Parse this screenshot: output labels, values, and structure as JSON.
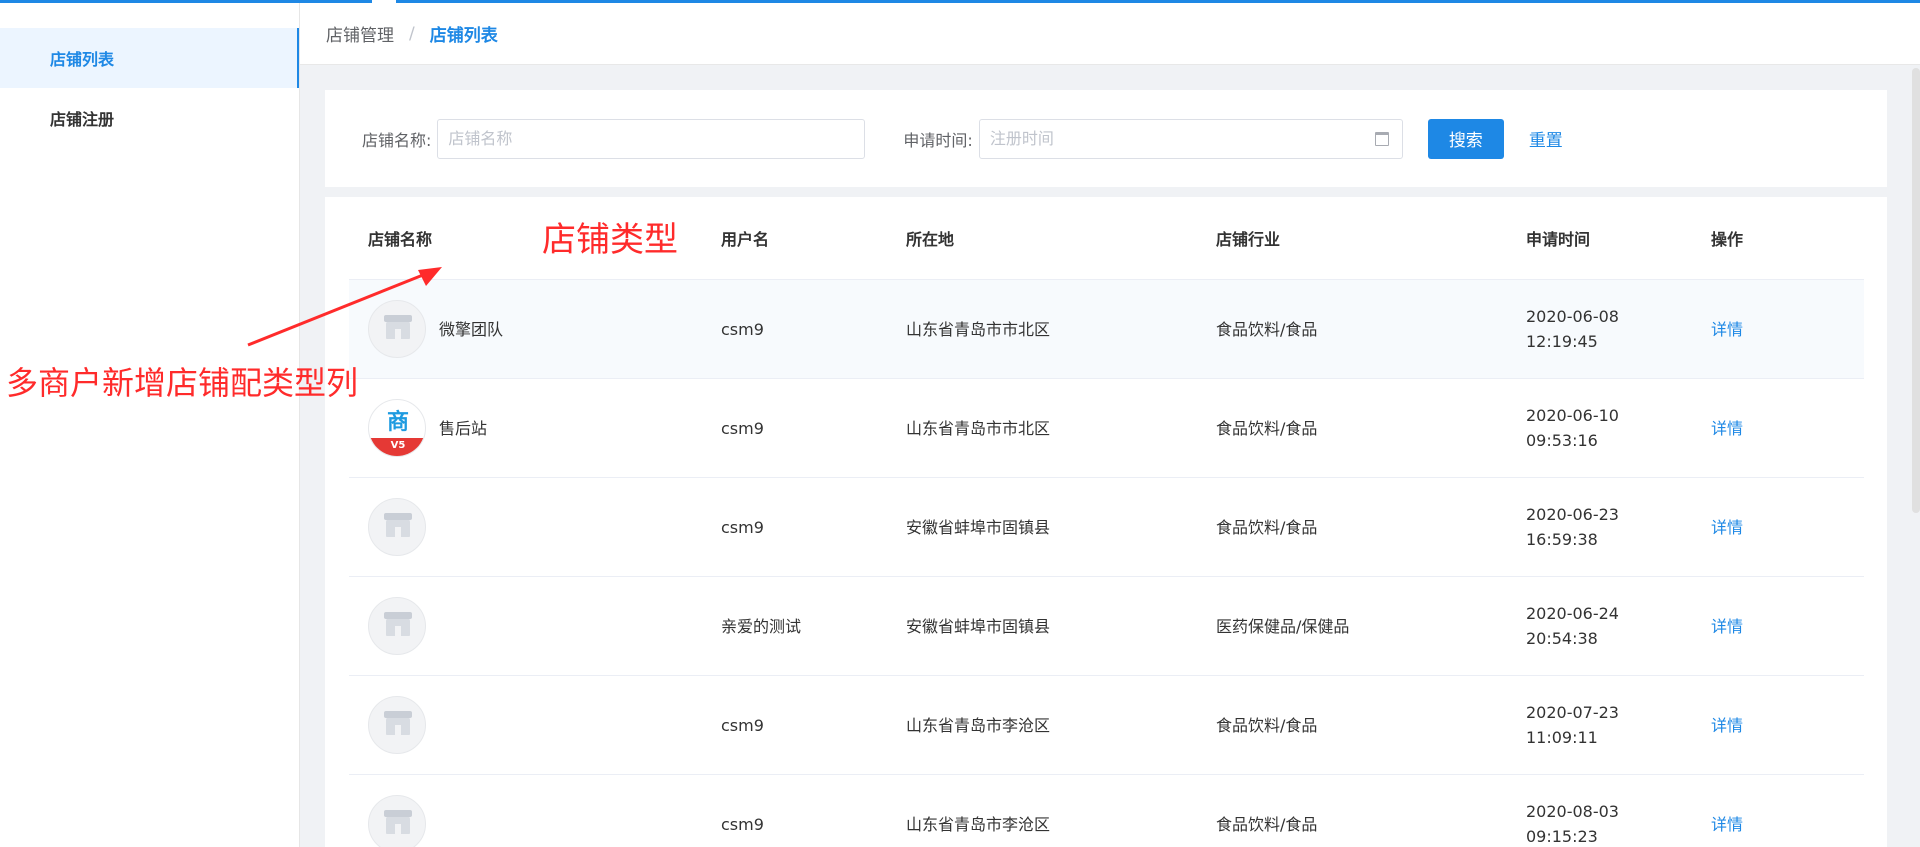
{
  "sidebar": {
    "items": [
      {
        "label": "店铺列表"
      },
      {
        "label": "店铺注册"
      }
    ]
  },
  "breadcrumb": {
    "parent": "店铺管理",
    "separator": "/",
    "current": "店铺列表"
  },
  "search": {
    "name_label": "店铺名称:",
    "name_placeholder": "店铺名称",
    "time_label": "申请时间:",
    "time_placeholder": "注册时间",
    "search_button": "搜索",
    "reset_link": "重置"
  },
  "table": {
    "headers": [
      "店铺名称",
      "用户名",
      "所在地",
      "店铺行业",
      "申请时间",
      "操作"
    ],
    "rows": [
      {
        "shop_name": "微擎团队",
        "avatar": "store-placeholder-icon",
        "username": "csm9",
        "location": "山东省青岛市市北区",
        "industry": "食品饮料/食品",
        "date": "2020-06-08",
        "time": "12:19:45",
        "action": "详情"
      },
      {
        "shop_name": "售后站",
        "avatar": "mall-logo",
        "username": "csm9",
        "location": "山东省青岛市市北区",
        "industry": "食品饮料/食品",
        "date": "2020-06-10",
        "time": "09:53:16",
        "action": "详情"
      },
      {
        "shop_name": "",
        "avatar": "store-placeholder-icon",
        "username": "csm9",
        "location": "安徽省蚌埠市固镇县",
        "industry": "食品饮料/食品",
        "date": "2020-06-23",
        "time": "16:59:38",
        "action": "详情"
      },
      {
        "shop_name": "",
        "avatar": "store-placeholder-icon",
        "username": "亲爱的测试",
        "location": "安徽省蚌埠市固镇县",
        "industry": "医药保健品/保健品",
        "date": "2020-06-24",
        "time": "20:54:38",
        "action": "详情"
      },
      {
        "shop_name": "",
        "avatar": "store-placeholder-icon",
        "username": "csm9",
        "location": "山东省青岛市李沧区",
        "industry": "食品饮料/食品",
        "date": "2020-07-23",
        "time": "11:09:11",
        "action": "详情"
      },
      {
        "shop_name": "",
        "avatar": "store-placeholder-icon",
        "username": "csm9",
        "location": "山东省青岛市李沧区",
        "industry": "食品饮料/食品",
        "date": "2020-08-03",
        "time": "09:15:23",
        "action": "详情"
      }
    ]
  },
  "logo": {
    "top_glyph": "商",
    "badge": "V5"
  },
  "annotations": {
    "type_label": "店铺类型",
    "note": "多商户新增店铺配类型列",
    "color": "#ff2b2b"
  },
  "colors": {
    "accent": "#1e88e5"
  }
}
